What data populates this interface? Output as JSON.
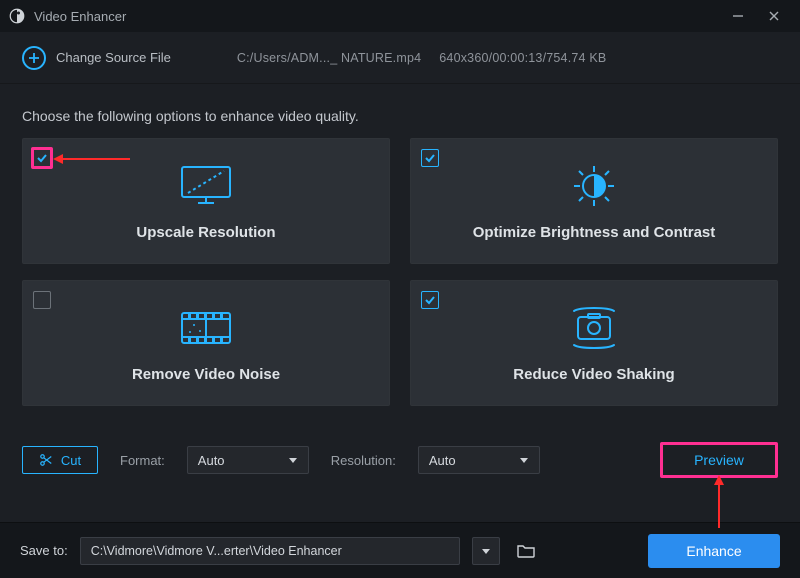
{
  "window": {
    "title": "Video Enhancer"
  },
  "header": {
    "change_label": "Change Source File",
    "path": "C:/Users/ADM..._ NATURE.mp4",
    "meta": "640x360/00:00:13/754.74 KB"
  },
  "instruction": "Choose the following options to enhance video quality.",
  "tiles": {
    "upscale": {
      "label": "Upscale Resolution",
      "checked": true,
      "highlight": true
    },
    "optimize": {
      "label": "Optimize Brightness and Contrast",
      "checked": true
    },
    "noise": {
      "label": "Remove Video Noise",
      "checked": false
    },
    "shaking": {
      "label": "Reduce Video Shaking",
      "checked": true
    }
  },
  "controls": {
    "cut_label": "Cut",
    "format_label": "Format:",
    "format_value": "Auto",
    "resolution_label": "Resolution:",
    "resolution_value": "Auto",
    "preview_label": "Preview"
  },
  "footer": {
    "saveto_label": "Save to:",
    "path": "C:\\Vidmore\\Vidmore V...erter\\Video Enhancer",
    "enhance_label": "Enhance"
  }
}
